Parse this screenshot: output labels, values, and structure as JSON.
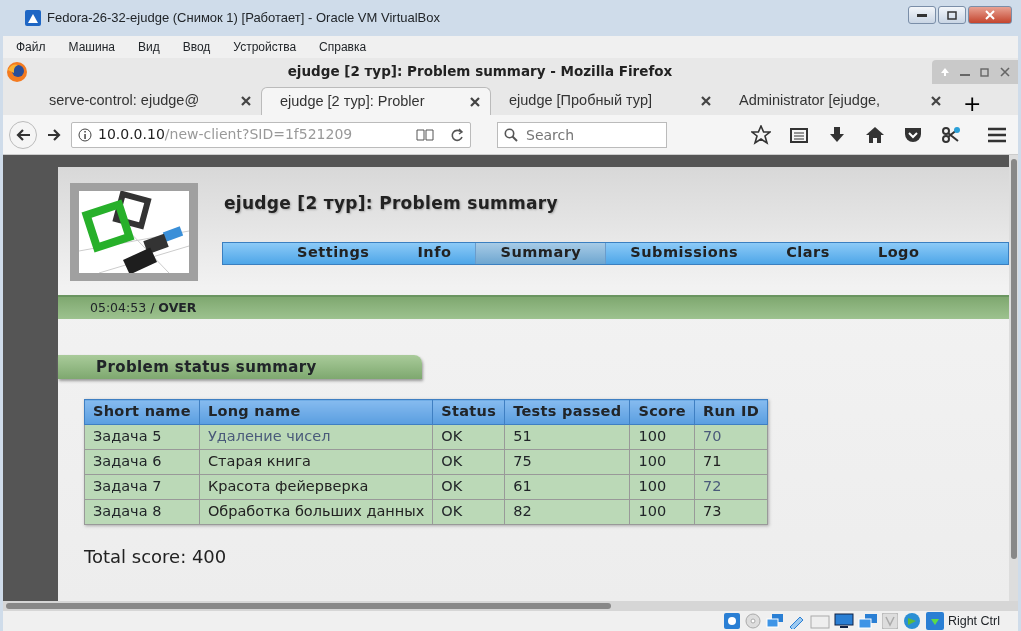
{
  "vm_window": {
    "title": "Fedora-26-32-ejudge (Снимок 1) [Работает] - Oracle VM VirtualBox"
  },
  "vm_menu": [
    "Файл",
    "Машина",
    "Вид",
    "Ввод",
    "Устройства",
    "Справка"
  ],
  "browser": {
    "title": "ejudge [2 тур]: Problem summary - Mozilla Firefox",
    "tabs": [
      {
        "label": "serve-control: ejudge@",
        "selected": false
      },
      {
        "label": "ejudge [2 тур]: Probler",
        "selected": true
      },
      {
        "label": "ejudge [Пробный тур]",
        "selected": false
      },
      {
        "label": "Administrator [ejudge,",
        "selected": false
      }
    ],
    "new_tab": "+",
    "url_host": "10.0.0.10",
    "url_path": "/new-client?SID=1f521209",
    "search": {
      "placeholder": "Search"
    }
  },
  "page": {
    "title": "ejudge [2 тур]: Problem summary",
    "nav": [
      {
        "label": "Settings",
        "selected": false
      },
      {
        "label": "Info",
        "selected": false
      },
      {
        "label": "Summary",
        "selected": true
      },
      {
        "label": "Submissions",
        "selected": false
      },
      {
        "label": "Clars",
        "selected": false
      },
      {
        "label": "Logo",
        "selected": false
      }
    ],
    "time": "05:04:53",
    "time_sep": "/",
    "state": "OVER",
    "section_title": "Problem status summary",
    "table": {
      "columns": [
        "Short name",
        "Long name",
        "Status",
        "Tests passed",
        "Score",
        "Run ID"
      ],
      "rows": [
        {
          "short_name": "Задача 5",
          "long_name": {
            "text": "Удаление чисел",
            "visited": true
          },
          "status": "OK",
          "tests_passed": "51",
          "score": "100",
          "run_id": {
            "text": "70",
            "visited": true
          }
        },
        {
          "short_name": "Задача 6",
          "long_name": {
            "text": "Старая книга",
            "visited": false
          },
          "status": "OK",
          "tests_passed": "75",
          "score": "100",
          "run_id": {
            "text": "71",
            "visited": false
          }
        },
        {
          "short_name": "Задача 7",
          "long_name": {
            "text": "Красота фейерверка",
            "visited": false
          },
          "status": "OK",
          "tests_passed": "61",
          "score": "100",
          "run_id": {
            "text": "72",
            "visited": true
          }
        },
        {
          "short_name": "Задача 8",
          "long_name": {
            "text": "Обработка больших данных",
            "visited": false
          },
          "status": "OK",
          "tests_passed": "82",
          "score": "100",
          "run_id": {
            "text": "73",
            "visited": false
          }
        }
      ]
    },
    "total_score": "Total score: 400"
  },
  "vm_status": {
    "host_key": "Right Ctrl"
  }
}
